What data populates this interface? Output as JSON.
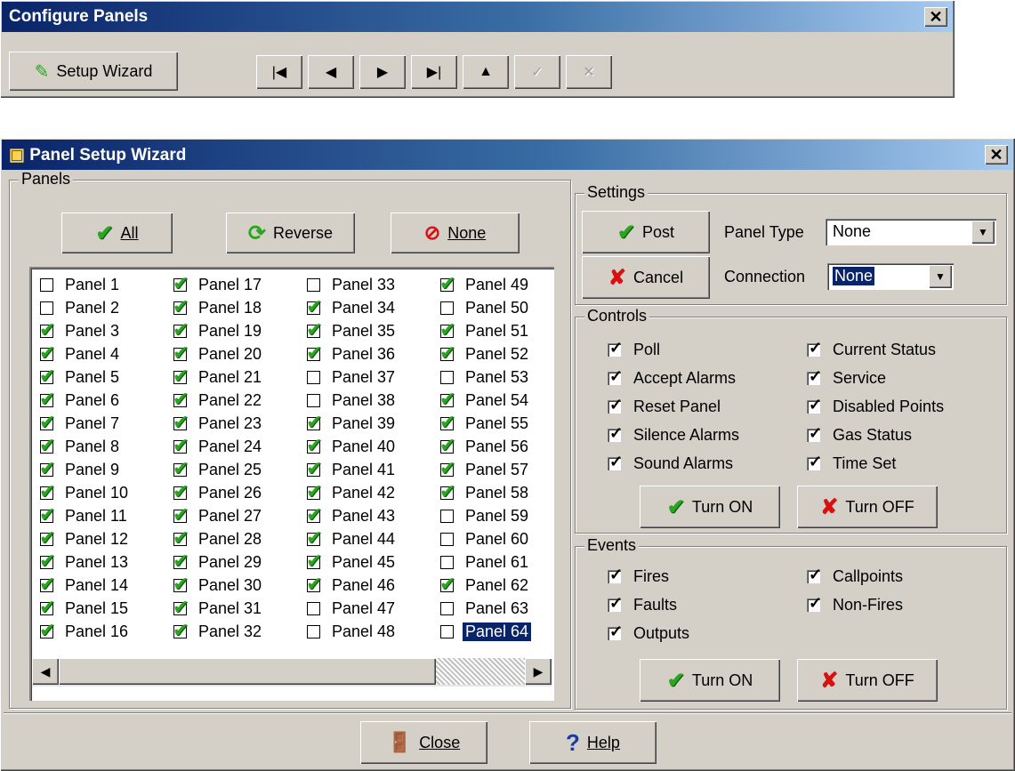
{
  "configure": {
    "title": "Configure Panels",
    "setup_wizard_label": "Setup Wizard",
    "nav": [
      {
        "name": "first-record-button",
        "glyph": "|◀",
        "disabled": false
      },
      {
        "name": "prior-record-button",
        "glyph": "◀",
        "disabled": false
      },
      {
        "name": "next-record-button",
        "glyph": "▶",
        "disabled": false
      },
      {
        "name": "last-record-button",
        "glyph": "▶|",
        "disabled": false
      },
      {
        "name": "insert-record-button",
        "glyph": "▲",
        "disabled": false
      },
      {
        "name": "post-edit-button",
        "glyph": "✓",
        "disabled": true
      },
      {
        "name": "cancel-edit-button",
        "glyph": "✕",
        "disabled": true
      }
    ]
  },
  "wizard": {
    "title": "Panel Setup Wizard",
    "panels_group": "Panels",
    "btn_all": "All",
    "btn_reverse": "Reverse",
    "btn_none": "None",
    "panels": [
      {
        "label": "Panel 1",
        "checked": false
      },
      {
        "label": "Panel 2",
        "checked": false
      },
      {
        "label": "Panel 3",
        "checked": true
      },
      {
        "label": "Panel 4",
        "checked": true
      },
      {
        "label": "Panel 5",
        "checked": true
      },
      {
        "label": "Panel 6",
        "checked": true
      },
      {
        "label": "Panel 7",
        "checked": true
      },
      {
        "label": "Panel 8",
        "checked": true
      },
      {
        "label": "Panel 9",
        "checked": true
      },
      {
        "label": "Panel 10",
        "checked": true
      },
      {
        "label": "Panel 11",
        "checked": true
      },
      {
        "label": "Panel 12",
        "checked": true
      },
      {
        "label": "Panel 13",
        "checked": true
      },
      {
        "label": "Panel 14",
        "checked": true
      },
      {
        "label": "Panel 15",
        "checked": true
      },
      {
        "label": "Panel 16",
        "checked": true
      },
      {
        "label": "Panel 17",
        "checked": true
      },
      {
        "label": "Panel 18",
        "checked": true
      },
      {
        "label": "Panel 19",
        "checked": true
      },
      {
        "label": "Panel 20",
        "checked": true
      },
      {
        "label": "Panel 21",
        "checked": true
      },
      {
        "label": "Panel 22",
        "checked": true
      },
      {
        "label": "Panel 23",
        "checked": true
      },
      {
        "label": "Panel 24",
        "checked": true
      },
      {
        "label": "Panel 25",
        "checked": true
      },
      {
        "label": "Panel 26",
        "checked": true
      },
      {
        "label": "Panel 27",
        "checked": true
      },
      {
        "label": "Panel 28",
        "checked": true
      },
      {
        "label": "Panel 29",
        "checked": true
      },
      {
        "label": "Panel 30",
        "checked": true
      },
      {
        "label": "Panel 31",
        "checked": true
      },
      {
        "label": "Panel 32",
        "checked": true
      },
      {
        "label": "Panel 33",
        "checked": false
      },
      {
        "label": "Panel 34",
        "checked": true
      },
      {
        "label": "Panel 35",
        "checked": true
      },
      {
        "label": "Panel 36",
        "checked": true
      },
      {
        "label": "Panel 37",
        "checked": false
      },
      {
        "label": "Panel 38",
        "checked": false
      },
      {
        "label": "Panel 39",
        "checked": true
      },
      {
        "label": "Panel 40",
        "checked": true
      },
      {
        "label": "Panel 41",
        "checked": true
      },
      {
        "label": "Panel 42",
        "checked": true
      },
      {
        "label": "Panel 43",
        "checked": true
      },
      {
        "label": "Panel 44",
        "checked": true
      },
      {
        "label": "Panel 45",
        "checked": true
      },
      {
        "label": "Panel 46",
        "checked": true
      },
      {
        "label": "Panel 47",
        "checked": false
      },
      {
        "label": "Panel 48",
        "checked": false
      },
      {
        "label": "Panel 49",
        "checked": true
      },
      {
        "label": "Panel 50",
        "checked": false
      },
      {
        "label": "Panel 51",
        "checked": true
      },
      {
        "label": "Panel 52",
        "checked": true
      },
      {
        "label": "Panel 53",
        "checked": false
      },
      {
        "label": "Panel 54",
        "checked": true
      },
      {
        "label": "Panel 55",
        "checked": true
      },
      {
        "label": "Panel 56",
        "checked": true
      },
      {
        "label": "Panel 57",
        "checked": true
      },
      {
        "label": "Panel 58",
        "checked": true
      },
      {
        "label": "Panel 59",
        "checked": false
      },
      {
        "label": "Panel 60",
        "checked": false
      },
      {
        "label": "Panel 61",
        "checked": false
      },
      {
        "label": "Panel 62",
        "checked": true
      },
      {
        "label": "Panel 63",
        "checked": false
      },
      {
        "label": "Panel 64",
        "checked": false,
        "selected": true
      }
    ],
    "settings": {
      "group": "Settings",
      "post": "Post",
      "cancel": "Cancel",
      "panel_type_label": "Panel Type",
      "panel_type_value": "None",
      "connection_label": "Connection",
      "connection_value": "None"
    },
    "controls": {
      "group": "Controls",
      "left": [
        {
          "label": "Poll",
          "checked": true
        },
        {
          "label": "Accept Alarms",
          "checked": true
        },
        {
          "label": "Reset Panel",
          "checked": true
        },
        {
          "label": "Silence Alarms",
          "checked": true
        },
        {
          "label": "Sound Alarms",
          "checked": true
        }
      ],
      "right": [
        {
          "label": "Current Status",
          "checked": true
        },
        {
          "label": "Service",
          "checked": true
        },
        {
          "label": "Disabled Points",
          "checked": true
        },
        {
          "label": "Gas Status",
          "checked": true
        },
        {
          "label": "Time Set",
          "checked": true
        }
      ],
      "turn_on": "Turn ON",
      "turn_off": "Turn OFF"
    },
    "events": {
      "group": "Events",
      "left": [
        {
          "label": "Fires",
          "checked": true
        },
        {
          "label": "Faults",
          "checked": true
        },
        {
          "label": "Outputs",
          "checked": true
        }
      ],
      "right": [
        {
          "label": "Callpoints",
          "checked": true
        },
        {
          "label": "Non-Fires",
          "checked": true
        }
      ],
      "turn_on": "Turn ON",
      "turn_off": "Turn OFF"
    },
    "close": "Close",
    "help": "Help"
  }
}
